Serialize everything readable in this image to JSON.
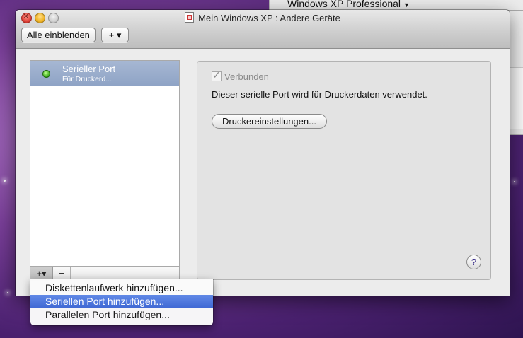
{
  "background_window": {
    "title": "Windows XP Professional",
    "dropdown_icon": "chevron-down-icon"
  },
  "window": {
    "title": "Mein Windows XP : Andere Geräte",
    "title_icon": "document-icon"
  },
  "toolbar": {
    "show_all_label": "Alle einblenden",
    "add_label": "+ ▾"
  },
  "device_list": {
    "items": [
      {
        "title": "Serieller Port",
        "subtitle": "Für Druckerd...",
        "status": "connected",
        "status_color": "#3aa81a"
      }
    ],
    "add_button_label": "+▾",
    "remove_button_label": "−"
  },
  "details": {
    "connected_label": "Verbunden",
    "connected_checked": true,
    "description": "Dieser serielle Port wird für Druckerdaten verwendet.",
    "printer_settings_button": "Druckereinstellungen...",
    "help_label": "?"
  },
  "add_menu": {
    "items": [
      {
        "label": "Diskettenlaufwerk hinzufügen..."
      },
      {
        "label": "Seriellen Port hinzufügen...",
        "highlighted": true
      },
      {
        "label": "Parallelen Port hinzufügen..."
      }
    ],
    "highlight_color": "#3f68d4"
  }
}
